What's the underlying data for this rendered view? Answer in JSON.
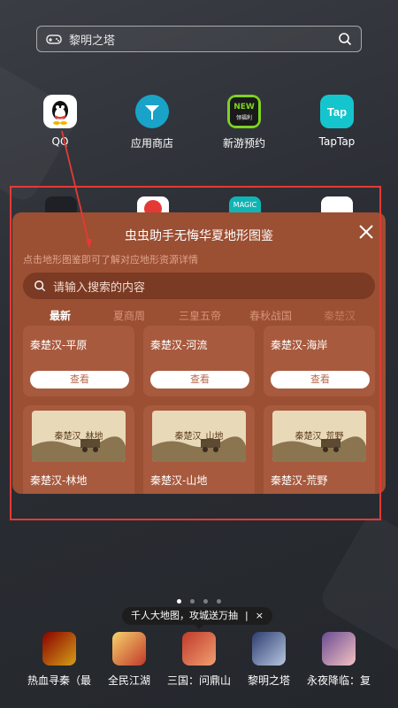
{
  "search": {
    "text": "黎明之塔"
  },
  "apps": [
    {
      "label": "QQ",
      "icon": "qq-penguin-icon"
    },
    {
      "label": "应用商店",
      "icon": "app-store-icon"
    },
    {
      "label": "新游预约",
      "icon": "new-game-reservation-icon"
    },
    {
      "label": "TapTap",
      "icon": "taptap-icon"
    }
  ],
  "app_tag": "领福利",
  "panel": {
    "title": "虫虫助手无悔华夏地形图鉴",
    "subtitle": "点击地形图鉴即可了解对应地形资源详情",
    "search_placeholder": "请输入搜索的内容",
    "tabs": [
      "最新",
      "夏商周",
      "三皇五帝",
      "春秋战国",
      "秦楚汉"
    ],
    "row1": [
      {
        "name": "秦楚汉-平原",
        "button": "查看"
      },
      {
        "name": "秦楚汉-河流",
        "button": "查看"
      },
      {
        "name": "秦楚汉-海岸",
        "button": "查看"
      }
    ],
    "row2": [
      {
        "name": "秦楚汉-林地",
        "thumb_text": "秦楚汉_林地"
      },
      {
        "name": "秦楚汉-山地",
        "thumb_text": "秦楚汉_山地"
      },
      {
        "name": "秦楚汉-荒野",
        "thumb_text": "秦楚汉_荒野"
      }
    ]
  },
  "promo": {
    "text": "千人大地图，攻城送万抽",
    "sep": "|",
    "close": "×"
  },
  "dock": [
    {
      "label": "热血寻秦（最",
      "icon": "xunqin-game-icon"
    },
    {
      "label": "全民江湖",
      "icon": "quanmin-jianghu-icon"
    },
    {
      "label": "三国：问鼎山",
      "icon": "sanguo-game-icon"
    },
    {
      "label": "黎明之塔",
      "icon": "liming-tower-icon"
    },
    {
      "label": "永夜降临：复",
      "icon": "yongye-game-icon"
    }
  ],
  "colors": {
    "panel": "#9b4f33",
    "accent_red": "#e53935"
  }
}
